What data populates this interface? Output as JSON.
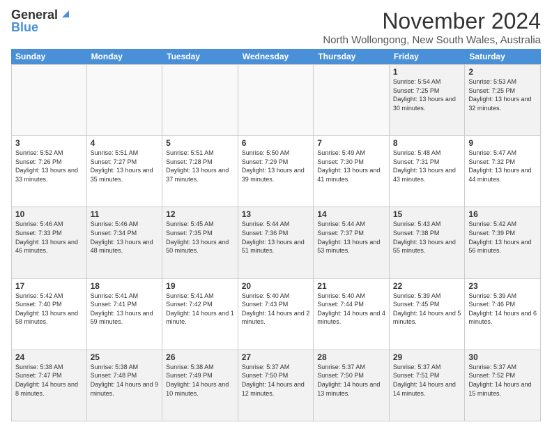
{
  "logo": {
    "general": "General",
    "blue": "Blue"
  },
  "header": {
    "month": "November 2024",
    "location": "North Wollongong, New South Wales, Australia"
  },
  "weekdays": [
    "Sunday",
    "Monday",
    "Tuesday",
    "Wednesday",
    "Thursday",
    "Friday",
    "Saturday"
  ],
  "rows": [
    [
      {
        "day": "",
        "empty": true
      },
      {
        "day": "",
        "empty": true
      },
      {
        "day": "",
        "empty": true
      },
      {
        "day": "",
        "empty": true
      },
      {
        "day": "",
        "empty": true
      },
      {
        "day": "1",
        "sunrise": "5:54 AM",
        "sunset": "7:25 PM",
        "daylight": "13 hours and 30 minutes."
      },
      {
        "day": "2",
        "sunrise": "5:53 AM",
        "sunset": "7:25 PM",
        "daylight": "13 hours and 32 minutes."
      }
    ],
    [
      {
        "day": "3",
        "sunrise": "5:52 AM",
        "sunset": "7:26 PM",
        "daylight": "13 hours and 33 minutes."
      },
      {
        "day": "4",
        "sunrise": "5:51 AM",
        "sunset": "7:27 PM",
        "daylight": "13 hours and 35 minutes."
      },
      {
        "day": "5",
        "sunrise": "5:51 AM",
        "sunset": "7:28 PM",
        "daylight": "13 hours and 37 minutes."
      },
      {
        "day": "6",
        "sunrise": "5:50 AM",
        "sunset": "7:29 PM",
        "daylight": "13 hours and 39 minutes."
      },
      {
        "day": "7",
        "sunrise": "5:49 AM",
        "sunset": "7:30 PM",
        "daylight": "13 hours and 41 minutes."
      },
      {
        "day": "8",
        "sunrise": "5:48 AM",
        "sunset": "7:31 PM",
        "daylight": "13 hours and 43 minutes."
      },
      {
        "day": "9",
        "sunrise": "5:47 AM",
        "sunset": "7:32 PM",
        "daylight": "13 hours and 44 minutes."
      }
    ],
    [
      {
        "day": "10",
        "sunrise": "5:46 AM",
        "sunset": "7:33 PM",
        "daylight": "13 hours and 46 minutes."
      },
      {
        "day": "11",
        "sunrise": "5:46 AM",
        "sunset": "7:34 PM",
        "daylight": "13 hours and 48 minutes."
      },
      {
        "day": "12",
        "sunrise": "5:45 AM",
        "sunset": "7:35 PM",
        "daylight": "13 hours and 50 minutes."
      },
      {
        "day": "13",
        "sunrise": "5:44 AM",
        "sunset": "7:36 PM",
        "daylight": "13 hours and 51 minutes."
      },
      {
        "day": "14",
        "sunrise": "5:44 AM",
        "sunset": "7:37 PM",
        "daylight": "13 hours and 53 minutes."
      },
      {
        "day": "15",
        "sunrise": "5:43 AM",
        "sunset": "7:38 PM",
        "daylight": "13 hours and 55 minutes."
      },
      {
        "day": "16",
        "sunrise": "5:42 AM",
        "sunset": "7:39 PM",
        "daylight": "13 hours and 56 minutes."
      }
    ],
    [
      {
        "day": "17",
        "sunrise": "5:42 AM",
        "sunset": "7:40 PM",
        "daylight": "13 hours and 58 minutes."
      },
      {
        "day": "18",
        "sunrise": "5:41 AM",
        "sunset": "7:41 PM",
        "daylight": "13 hours and 59 minutes."
      },
      {
        "day": "19",
        "sunrise": "5:41 AM",
        "sunset": "7:42 PM",
        "daylight": "14 hours and 1 minute."
      },
      {
        "day": "20",
        "sunrise": "5:40 AM",
        "sunset": "7:43 PM",
        "daylight": "14 hours and 2 minutes."
      },
      {
        "day": "21",
        "sunrise": "5:40 AM",
        "sunset": "7:44 PM",
        "daylight": "14 hours and 4 minutes."
      },
      {
        "day": "22",
        "sunrise": "5:39 AM",
        "sunset": "7:45 PM",
        "daylight": "14 hours and 5 minutes."
      },
      {
        "day": "23",
        "sunrise": "5:39 AM",
        "sunset": "7:46 PM",
        "daylight": "14 hours and 6 minutes."
      }
    ],
    [
      {
        "day": "24",
        "sunrise": "5:38 AM",
        "sunset": "7:47 PM",
        "daylight": "14 hours and 8 minutes."
      },
      {
        "day": "25",
        "sunrise": "5:38 AM",
        "sunset": "7:48 PM",
        "daylight": "14 hours and 9 minutes."
      },
      {
        "day": "26",
        "sunrise": "5:38 AM",
        "sunset": "7:49 PM",
        "daylight": "14 hours and 10 minutes."
      },
      {
        "day": "27",
        "sunrise": "5:37 AM",
        "sunset": "7:50 PM",
        "daylight": "14 hours and 12 minutes."
      },
      {
        "day": "28",
        "sunrise": "5:37 AM",
        "sunset": "7:50 PM",
        "daylight": "14 hours and 13 minutes."
      },
      {
        "day": "29",
        "sunrise": "5:37 AM",
        "sunset": "7:51 PM",
        "daylight": "14 hours and 14 minutes."
      },
      {
        "day": "30",
        "sunrise": "5:37 AM",
        "sunset": "7:52 PM",
        "daylight": "14 hours and 15 minutes."
      }
    ]
  ]
}
